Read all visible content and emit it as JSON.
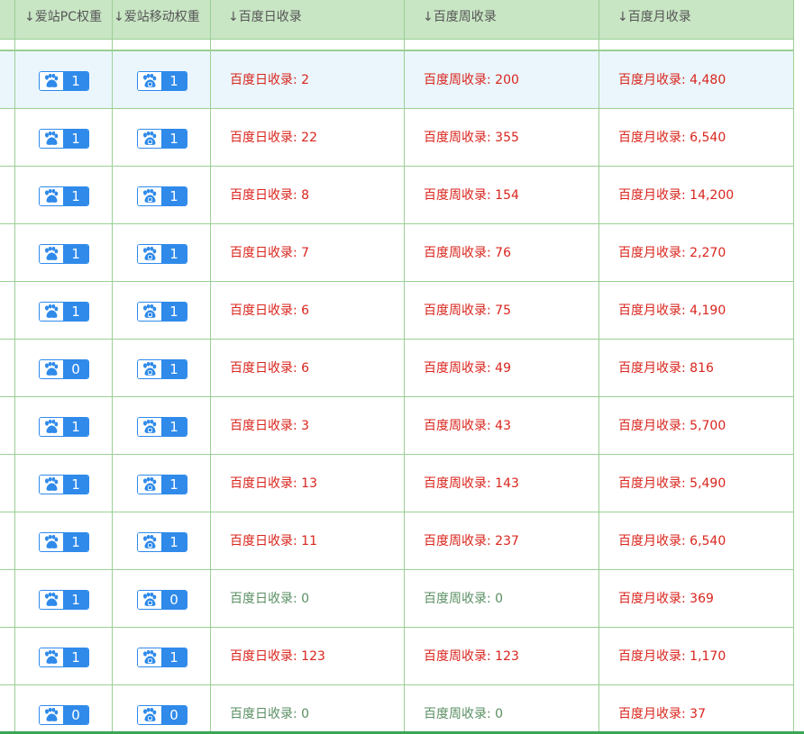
{
  "colors": {
    "header_bg": "#c8e5c4",
    "border": "#9bcf95",
    "badge_blue": "#2f8aea",
    "value_red": "#d9251d",
    "value_zero_green": "#5a8f63",
    "highlight_row": "#eaf6fc"
  },
  "header": {
    "col_pc_weight": "↓爱站PC权重",
    "col_mobile_weight": "↓爱站移动权重",
    "col_daily": "↓百度日收录",
    "col_weekly": "↓百度周收录",
    "col_monthly": "↓百度月收录"
  },
  "labels": {
    "daily_prefix": "百度日收录: ",
    "weekly_prefix": "百度周收录: ",
    "monthly_prefix": "百度月收录: "
  },
  "icons": {
    "pc_badge": "baidu-paw-icon",
    "mobile_badge": "baidu-mobile-paw-icon"
  },
  "rows": [
    {
      "pc": "1",
      "mobile": "1",
      "daily": "百度日收录: 2",
      "weekly": "百度周收录: 200",
      "monthly": "百度月收录: 4,480",
      "highlighted": true
    },
    {
      "pc": "1",
      "mobile": "1",
      "daily": "百度日收录: 22",
      "weekly": "百度周收录: 355",
      "monthly": "百度月收录: 6,540"
    },
    {
      "pc": "1",
      "mobile": "1",
      "daily": "百度日收录: 8",
      "weekly": "百度周收录: 154",
      "monthly": "百度月收录: 14,200"
    },
    {
      "pc": "1",
      "mobile": "1",
      "daily": "百度日收录: 7",
      "weekly": "百度周收录: 76",
      "monthly": "百度月收录: 2,270"
    },
    {
      "pc": "1",
      "mobile": "1",
      "daily": "百度日收录: 6",
      "weekly": "百度周收录: 75",
      "monthly": "百度月收录: 4,190"
    },
    {
      "pc": "0",
      "mobile": "1",
      "daily": "百度日收录: 6",
      "weekly": "百度周收录: 49",
      "monthly": "百度月收录: 816"
    },
    {
      "pc": "1",
      "mobile": "1",
      "daily": "百度日收录: 3",
      "weekly": "百度周收录: 43",
      "monthly": "百度月收录: 5,700"
    },
    {
      "pc": "1",
      "mobile": "1",
      "daily": "百度日收录: 13",
      "weekly": "百度周收录: 143",
      "monthly": "百度月收录: 5,490"
    },
    {
      "pc": "1",
      "mobile": "1",
      "daily": "百度日收录: 11",
      "weekly": "百度周收录: 237",
      "monthly": "百度月收录: 6,540"
    },
    {
      "pc": "1",
      "mobile": "0",
      "daily": "百度日收录: 0",
      "weekly": "百度周收录: 0",
      "monthly": "百度月收录: 369",
      "daily_zero": true,
      "weekly_zero": true
    },
    {
      "pc": "1",
      "mobile": "1",
      "daily": "百度日收录: 123",
      "weekly": "百度周收录: 123",
      "monthly": "百度月收录: 1,170"
    },
    {
      "pc": "0",
      "mobile": "0",
      "daily": "百度日收录: 0",
      "weekly": "百度周收录: 0",
      "monthly": "百度月收录: 37",
      "daily_zero": true,
      "weekly_zero": true
    }
  ]
}
